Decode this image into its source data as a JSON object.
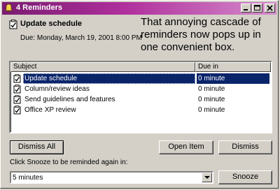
{
  "window": {
    "title": "4 Reminders",
    "controls": {
      "minimize": "_",
      "maximize": "□",
      "close": "✕"
    },
    "accent_color": "#7a1b71"
  },
  "header": {
    "subject": "Update schedule",
    "due": "Due: Monday, March 19, 2001 8:00 PM",
    "icon": "clipboard-check-icon"
  },
  "caption": "That annoying cascade of reminders now pops up in one convenient box.",
  "list": {
    "columns": {
      "subject": "Subject",
      "due": "Due in"
    },
    "rows": [
      {
        "subject": "Update schedule",
        "due": "0 minute",
        "selected": true
      },
      {
        "subject": "Column/review ideas",
        "due": "0 minute",
        "selected": false
      },
      {
        "subject": "Send guidelines and features",
        "due": "0 minute",
        "selected": false
      },
      {
        "subject": "Office XP review",
        "due": "0 minute",
        "selected": false
      }
    ],
    "selection_color": "#0a246a"
  },
  "buttons": {
    "dismiss_all": "Dismiss All",
    "open_item": "Open Item",
    "dismiss": "Dismiss",
    "snooze": "Snooze"
  },
  "snooze": {
    "label": "Click Snooze to be reminded again in:",
    "value": "5 minutes"
  }
}
